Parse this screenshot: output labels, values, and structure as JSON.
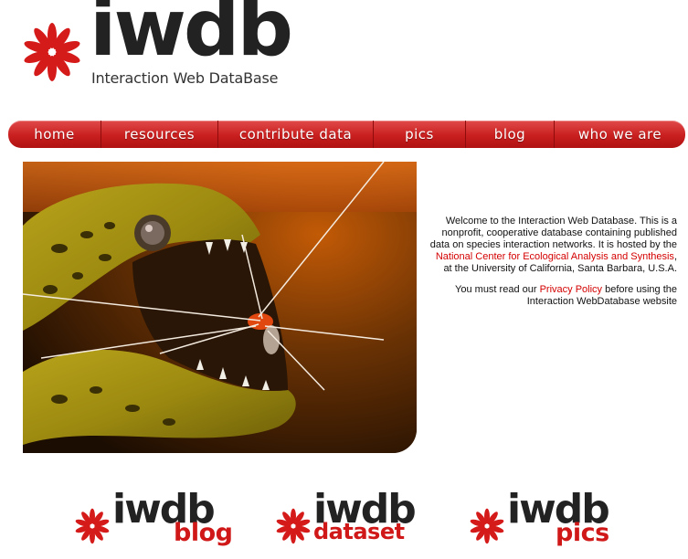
{
  "header": {
    "logo_word": "iwdb",
    "logo_subtitle": "Interaction Web DataBase"
  },
  "nav": {
    "items": [
      "home",
      "resources",
      "contribute data",
      "pics",
      "blog",
      "who we are"
    ]
  },
  "welcome": {
    "intro": "Welcome to the Interaction Web Database. This is a nonprofit, cooperative database containing published data on species interaction networks. It is hosted by the",
    "link_nceas": "National Center for Ecological Analysis and Synthesis",
    "location": ", at the University of California, Santa Barbara, U.S.A.",
    "privacy_pre": "You must read our",
    "link_privacy": "Privacy Policy",
    "privacy_post": "before using the Interaction WebDatabase website"
  },
  "sublogos": [
    {
      "word": "iwdb",
      "tag": "blog"
    },
    {
      "word": "iwdb",
      "tag": "dataset"
    },
    {
      "word": "iwdb",
      "tag": "pics"
    }
  ],
  "colors": {
    "brand_red": "#d01818",
    "nav_red": "#c91f1f",
    "link_red": "#d40000",
    "text_dark": "#222222"
  },
  "icons": {
    "logo_flower": "red-flower-icon"
  }
}
